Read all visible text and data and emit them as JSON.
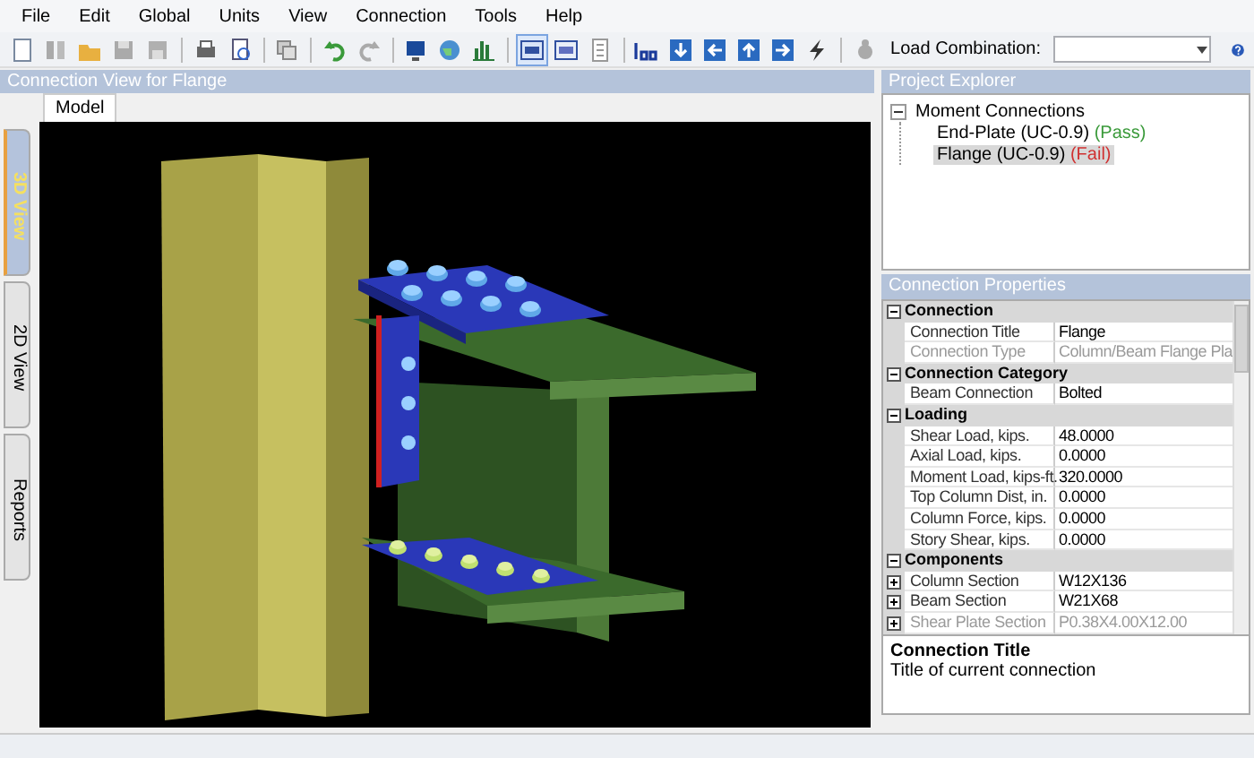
{
  "menu": [
    "File",
    "Edit",
    "Global",
    "Units",
    "View",
    "Connection",
    "Tools",
    "Help"
  ],
  "toolbar": {
    "load_combination": {
      "label": "Load Combination:"
    }
  },
  "view_pane": {
    "title": "Connection View for Flange",
    "tabs": [
      {
        "label": "Model",
        "selected": true
      }
    ],
    "side_tabs": [
      {
        "label": "3D View",
        "selected": true
      },
      {
        "label": "2D View",
        "selected": false
      },
      {
        "label": "Reports",
        "selected": false
      }
    ]
  },
  "project_explorer": {
    "title": "Project Explorer",
    "tree": [
      {
        "label": "Moment Connections",
        "expanded": true,
        "selected": false,
        "children": [
          {
            "label": "End-Plate (UC-0.9)",
            "status": "(Pass)",
            "color": "#3a9a3a",
            "selected": false
          },
          {
            "label": "Flange (UC-0.9)",
            "status": "(Fail)",
            "color": "#d03030",
            "selected": true
          }
        ]
      }
    ]
  },
  "connection_properties": {
    "title": "Connection Properties",
    "rows": [
      {
        "kind": "category",
        "label": "Connection",
        "expanded": true
      },
      {
        "kind": "property",
        "label": "Connection Title",
        "value": "Flange",
        "disabled": false
      },
      {
        "kind": "property",
        "label": "Connection Type",
        "value": "Column/Beam Flange Pla",
        "disabled": true
      },
      {
        "kind": "category",
        "label": "Connection Category",
        "expanded": true
      },
      {
        "kind": "property",
        "label": "Beam Connection",
        "value": "Bolted",
        "disabled": false
      },
      {
        "kind": "category",
        "label": "Loading",
        "expanded": true
      },
      {
        "kind": "property",
        "label": "Shear Load, kips.",
        "value": "48.0000",
        "disabled": false
      },
      {
        "kind": "property",
        "label": "Axial Load, kips.",
        "value": "0.0000",
        "disabled": false
      },
      {
        "kind": "property",
        "label": "Moment Load, kips-ft.",
        "value": "320.0000",
        "disabled": false
      },
      {
        "kind": "property",
        "label": "Top Column Dist, in.",
        "value": "0.0000",
        "disabled": false
      },
      {
        "kind": "property",
        "label": "Column Force, kips.",
        "value": "0.0000",
        "disabled": false
      },
      {
        "kind": "property",
        "label": "Story Shear, kips.",
        "value": "0.0000",
        "disabled": false
      },
      {
        "kind": "category",
        "label": "Components",
        "expanded": true
      },
      {
        "kind": "property",
        "label": "Column Section",
        "value": "W12X136",
        "disabled": false,
        "expanded": false
      },
      {
        "kind": "property",
        "label": "Beam Section",
        "value": "W21X68",
        "disabled": false,
        "expanded": false
      },
      {
        "kind": "property",
        "label": "Shear Plate Section",
        "value": "P0.38X4.00X12.00",
        "disabled": true,
        "expanded": false
      }
    ],
    "description": {
      "title": "Connection Title",
      "text": "Title of current connection"
    }
  }
}
